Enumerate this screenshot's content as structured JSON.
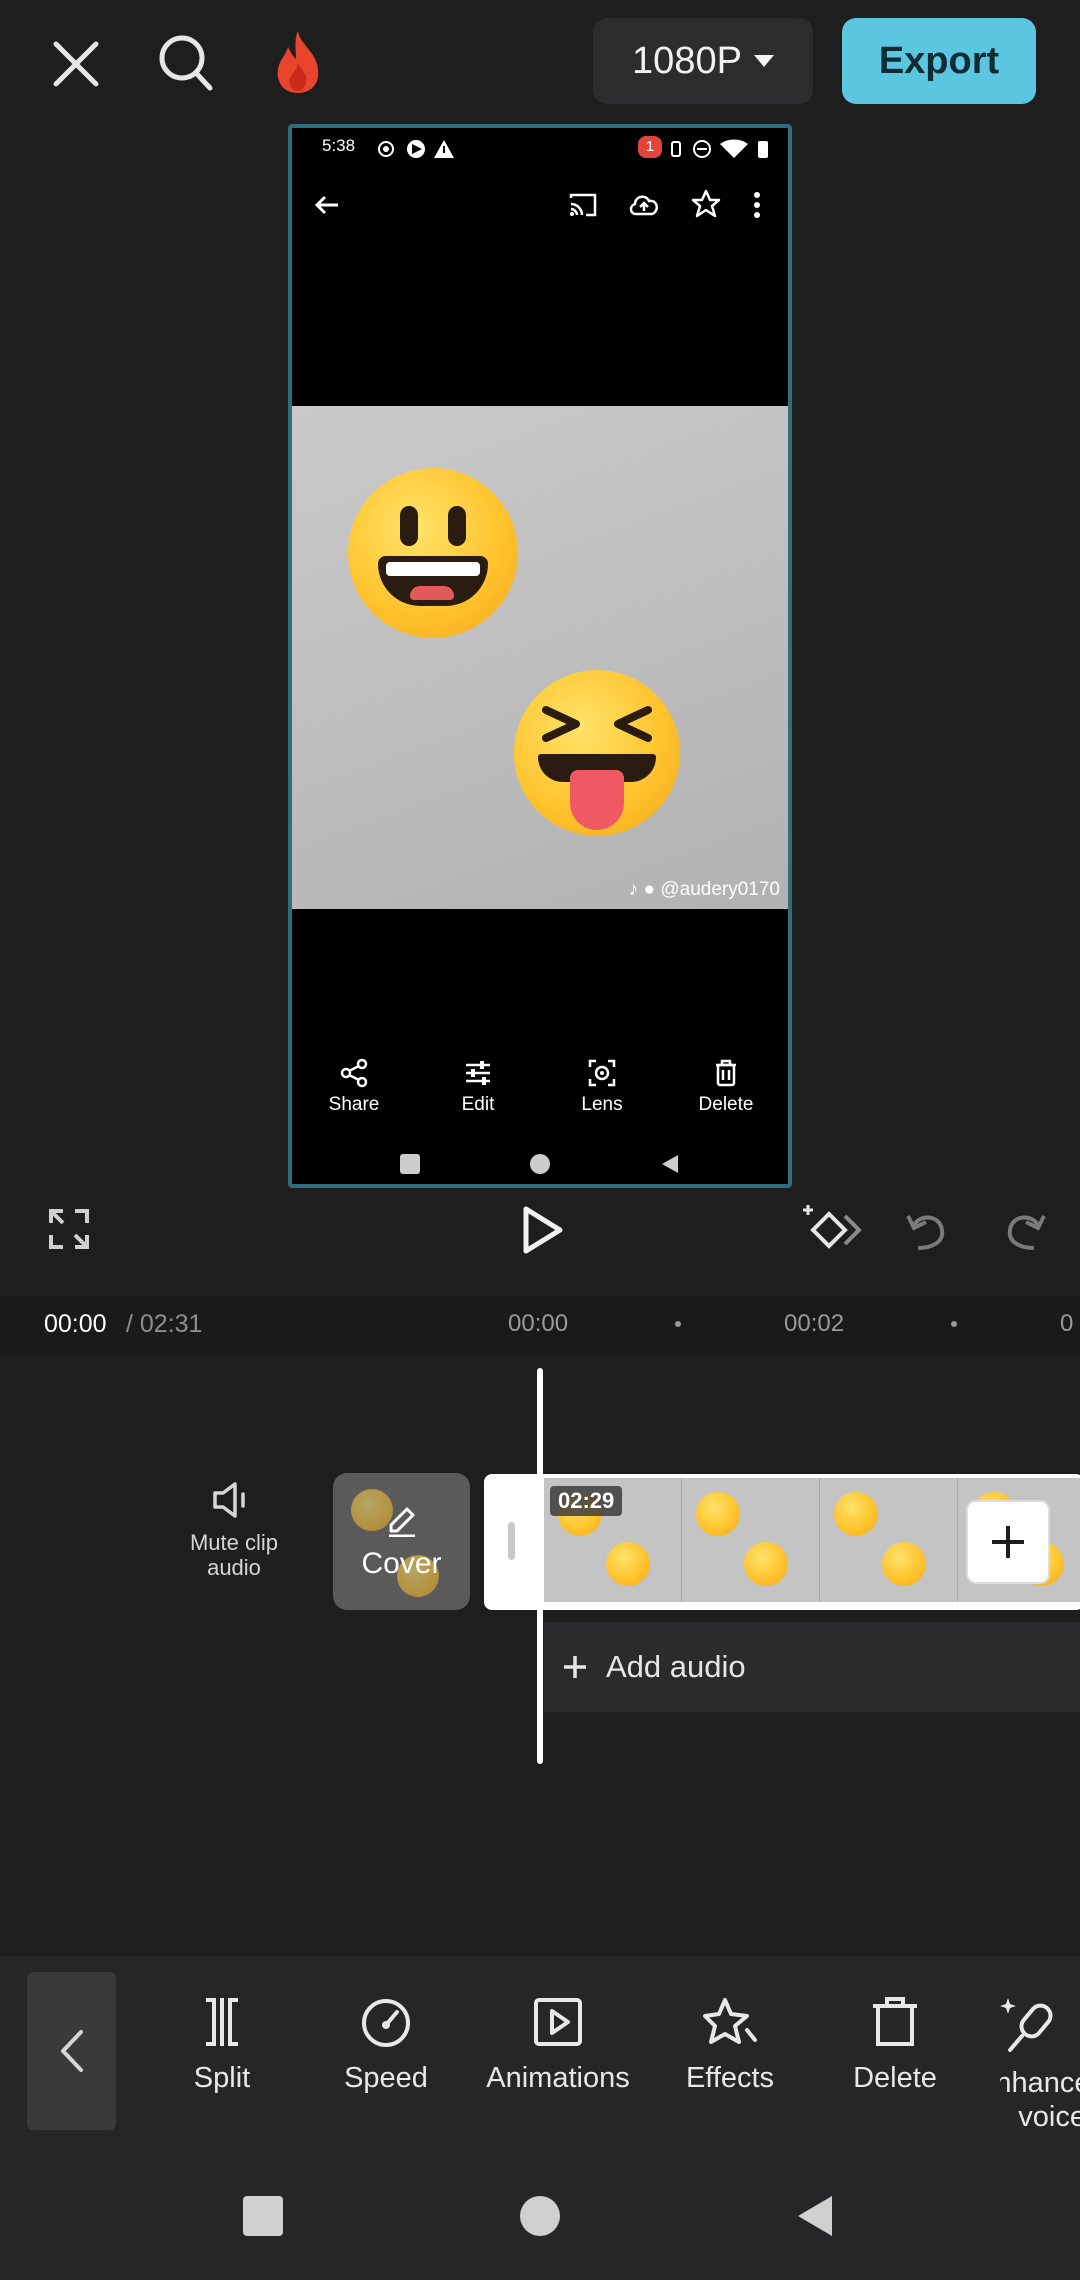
{
  "topbar": {
    "resolution": "1080P",
    "export_label": "Export"
  },
  "preview": {
    "status_time": "5:38",
    "notification_count": "1",
    "watermark": "@audery0170",
    "actions": [
      {
        "label": "Share",
        "icon": "share-icon"
      },
      {
        "label": "Edit",
        "icon": "sliders-icon"
      },
      {
        "label": "Lens",
        "icon": "lens-icon"
      },
      {
        "label": "Delete",
        "icon": "trash-icon"
      }
    ]
  },
  "timeline": {
    "current_time": "00:00",
    "total_time": "/ 02:31",
    "ruler_marks": [
      "00:00",
      "00:02",
      "0"
    ],
    "mute_label": "Mute clip audio",
    "cover_label": "Cover",
    "clip_duration": "02:29",
    "add_audio_label": "Add audio"
  },
  "toolbar": {
    "items": [
      {
        "label": "Split",
        "icon": "split-icon"
      },
      {
        "label": "Speed",
        "icon": "speed-icon"
      },
      {
        "label": "Animations",
        "icon": "animations-icon"
      },
      {
        "label": "Effects",
        "icon": "effects-icon"
      },
      {
        "label": "Delete",
        "icon": "delete-icon"
      },
      {
        "label": "Enhance voice",
        "icon": "enhance-voice-icon"
      }
    ]
  },
  "colors": {
    "accent": "#5bc6e0",
    "preview_border": "#2f6e7d",
    "background": "#1e1e1e"
  }
}
